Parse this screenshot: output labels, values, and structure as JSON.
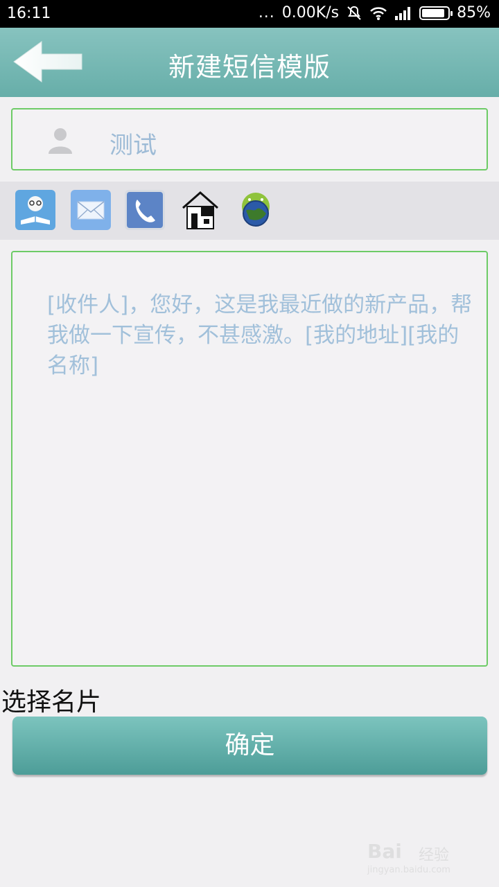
{
  "status_bar": {
    "time": "16:11",
    "dots": "...",
    "network_speed": "0.00K/s",
    "battery_percent": "85%",
    "icons": [
      "mute-icon",
      "wifi-icon",
      "signal-icon",
      "battery-icon"
    ]
  },
  "header": {
    "title": "新建短信模版",
    "back_icon": "back-arrow-icon",
    "color": "#75b7b3"
  },
  "recipient": {
    "name": "测试",
    "icon": "person-icon"
  },
  "toolbar": {
    "items": [
      {
        "icon": "contact-card-icon"
      },
      {
        "icon": "mail-icon"
      },
      {
        "icon": "phone-icon"
      },
      {
        "icon": "house-icon"
      },
      {
        "icon": "android-globe-icon"
      }
    ]
  },
  "message": {
    "text": "[收件人]，您好，这是我最近做的新产品，帮我做一下宣传，不甚感激。[我的地址][我的名称]"
  },
  "select_card_label": "选择名片",
  "confirm_button": "确定",
  "watermark": {
    "brand": "Bai",
    "sub": "经验",
    "url": "jingyan.baidu.com"
  },
  "colors": {
    "accent_border": "#6dcb66",
    "button": "#5ba9a4",
    "placeholder_text": "#a1c0da"
  }
}
